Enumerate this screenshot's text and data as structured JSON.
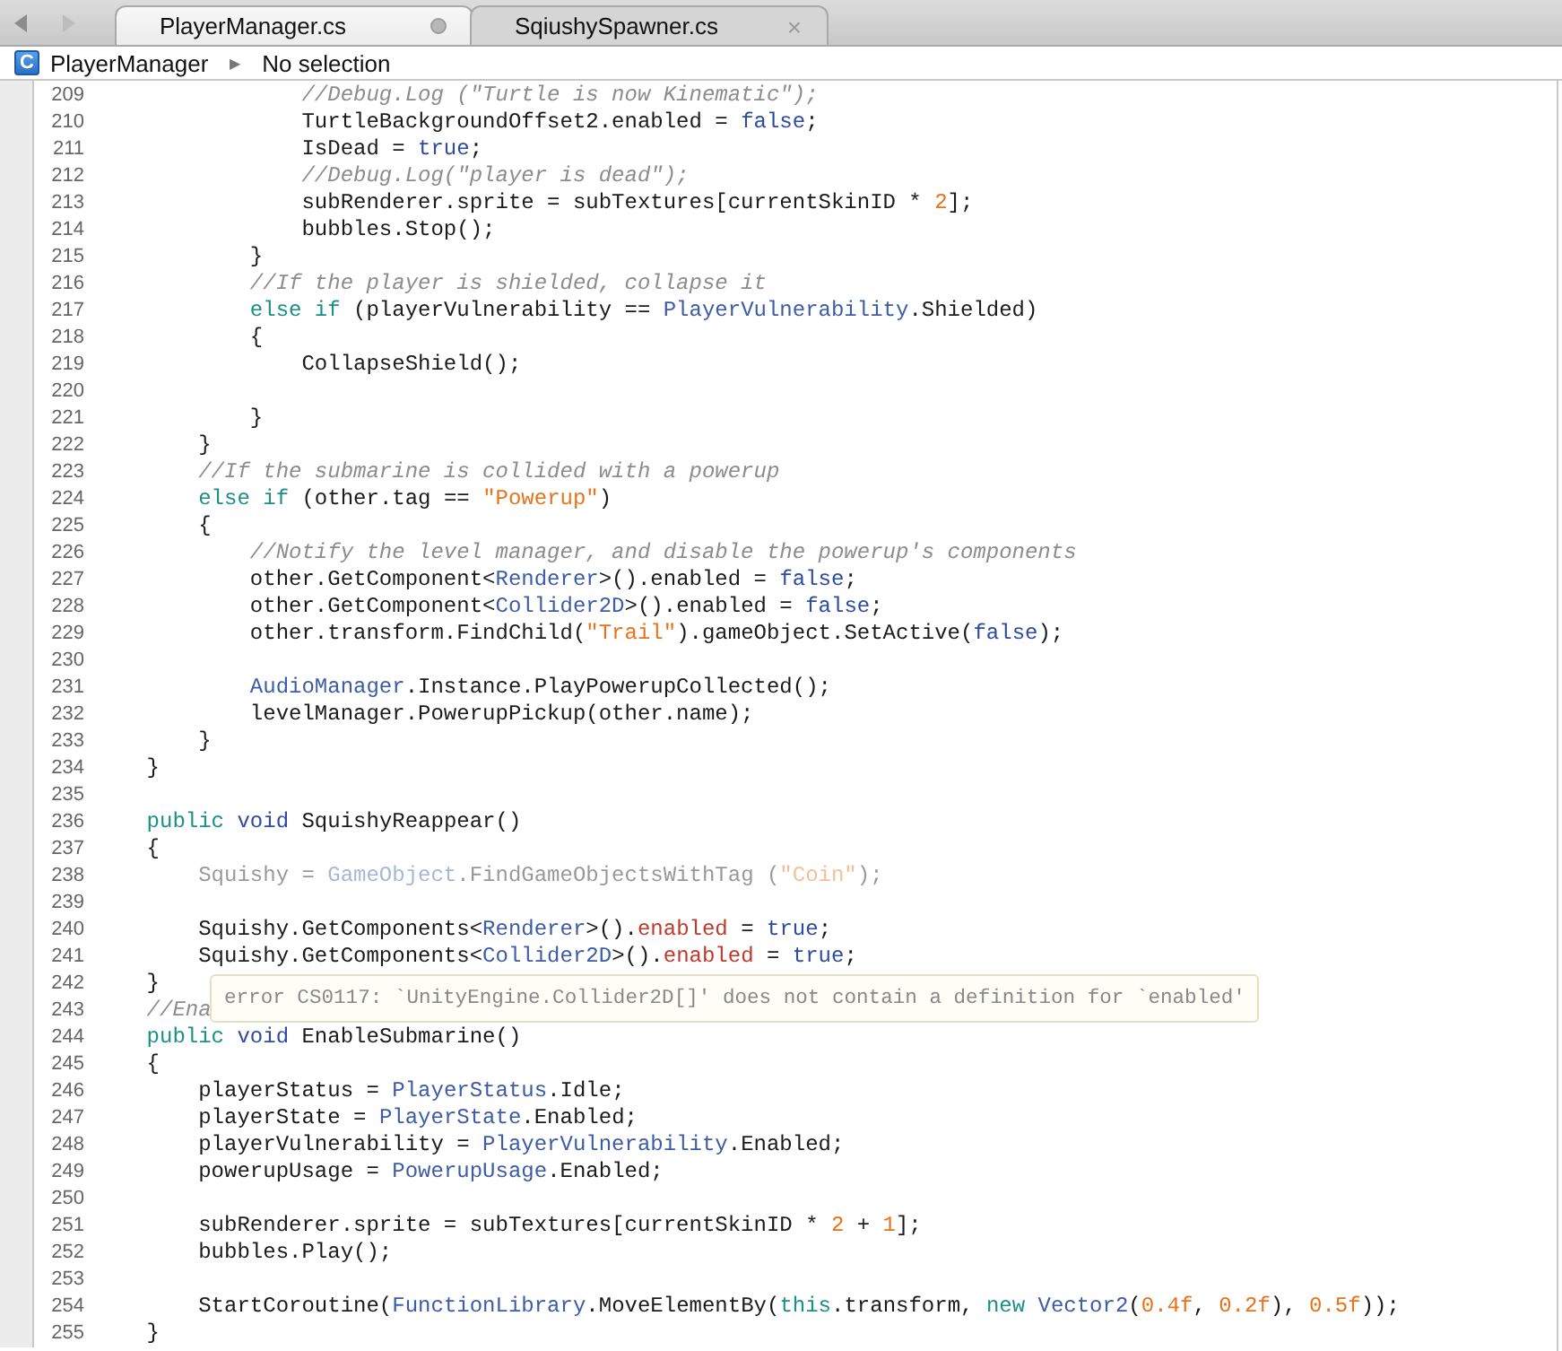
{
  "tabs": [
    {
      "label": "PlayerManager.cs",
      "selected": true,
      "modified": true
    },
    {
      "label": "SqiushySpawner.cs",
      "selected": false,
      "modified": false,
      "close": "×"
    }
  ],
  "breadcrumb": {
    "badge": "C",
    "class_name": "PlayerManager",
    "separator": "▶",
    "member": "No selection"
  },
  "lines": [
    {
      "number": "209",
      "tokens": [
        {
          "kind": "comment",
          "text": "                //Debug.Log (\"Turtle is now Kinematic\");"
        }
      ]
    },
    {
      "number": "210",
      "tokens": [
        {
          "kind": "plain",
          "text": "                TurtleBackgroundOffset2.enabled = "
        },
        {
          "kind": "literal",
          "text": "false"
        },
        {
          "kind": "plain",
          "text": ";"
        }
      ]
    },
    {
      "number": "211",
      "tokens": [
        {
          "kind": "plain",
          "text": "                IsDead = "
        },
        {
          "kind": "literal",
          "text": "true"
        },
        {
          "kind": "plain",
          "text": ";"
        }
      ]
    },
    {
      "number": "212",
      "tokens": [
        {
          "kind": "comment",
          "text": "                //Debug.Log(\"player is dead\");"
        }
      ]
    },
    {
      "number": "213",
      "tokens": [
        {
          "kind": "plain",
          "text": "                subRenderer.sprite = subTextures[currentSkinID * "
        },
        {
          "kind": "number",
          "text": "2"
        },
        {
          "kind": "plain",
          "text": "];"
        }
      ]
    },
    {
      "number": "214",
      "tokens": [
        {
          "kind": "plain",
          "text": "                bubbles.Stop();"
        }
      ]
    },
    {
      "number": "215",
      "tokens": [
        {
          "kind": "plain",
          "text": "            }"
        }
      ]
    },
    {
      "number": "216",
      "tokens": [
        {
          "kind": "comment",
          "text": "            //If the player is shielded, collapse it"
        }
      ]
    },
    {
      "number": "217",
      "tokens": [
        {
          "kind": "keyword",
          "text": "            else if"
        },
        {
          "kind": "plain",
          "text": " (playerVulnerability == "
        },
        {
          "kind": "type",
          "text": "PlayerVulnerability"
        },
        {
          "kind": "plain",
          "text": ".Shielded)"
        }
      ]
    },
    {
      "number": "218",
      "tokens": [
        {
          "kind": "plain",
          "text": "            {"
        }
      ]
    },
    {
      "number": "219",
      "tokens": [
        {
          "kind": "plain",
          "text": "                CollapseShield();"
        }
      ]
    },
    {
      "number": "220"
    },
    {
      "number": "221",
      "tokens": [
        {
          "kind": "plain",
          "text": "            }"
        }
      ]
    },
    {
      "number": "222",
      "tokens": [
        {
          "kind": "plain",
          "text": "        }"
        }
      ]
    },
    {
      "number": "223",
      "tokens": [
        {
          "kind": "comment",
          "text": "        //If the submarine is collided with a powerup"
        }
      ]
    },
    {
      "number": "224",
      "tokens": [
        {
          "kind": "keyword",
          "text": "        else if"
        },
        {
          "kind": "plain",
          "text": " (other.tag == "
        },
        {
          "kind": "string",
          "text": "\"Powerup\""
        },
        {
          "kind": "plain",
          "text": ")"
        }
      ]
    },
    {
      "number": "225",
      "tokens": [
        {
          "kind": "plain",
          "text": "        {"
        }
      ]
    },
    {
      "number": "226",
      "tokens": [
        {
          "kind": "comment",
          "text": "            //Notify the level manager, and disable the powerup's components"
        }
      ]
    },
    {
      "number": "227",
      "tokens": [
        {
          "kind": "plain",
          "text": "            other.GetComponent<"
        },
        {
          "kind": "type",
          "text": "Renderer"
        },
        {
          "kind": "plain",
          "text": ">().enabled = "
        },
        {
          "kind": "literal",
          "text": "false"
        },
        {
          "kind": "plain",
          "text": ";"
        }
      ]
    },
    {
      "number": "228",
      "tokens": [
        {
          "kind": "plain",
          "text": "            other.GetComponent<"
        },
        {
          "kind": "type",
          "text": "Collider2D"
        },
        {
          "kind": "plain",
          "text": ">().enabled = "
        },
        {
          "kind": "literal",
          "text": "false"
        },
        {
          "kind": "plain",
          "text": ";"
        }
      ]
    },
    {
      "number": "229",
      "tokens": [
        {
          "kind": "plain",
          "text": "            other.transform.FindChild("
        },
        {
          "kind": "string",
          "text": "\"Trail\""
        },
        {
          "kind": "plain",
          "text": ").gameObject.SetActive("
        },
        {
          "kind": "literal",
          "text": "false"
        },
        {
          "kind": "plain",
          "text": ");"
        }
      ]
    },
    {
      "number": "230"
    },
    {
      "number": "231",
      "tokens": [
        {
          "kind": "type",
          "text": "            AudioManager"
        },
        {
          "kind": "plain",
          "text": ".Instance.PlayPowerupCollected();"
        }
      ]
    },
    {
      "number": "232",
      "tokens": [
        {
          "kind": "plain",
          "text": "            levelManager.PowerupPickup(other.name);"
        }
      ]
    },
    {
      "number": "233",
      "tokens": [
        {
          "kind": "plain",
          "text": "        }"
        }
      ]
    },
    {
      "number": "234",
      "tokens": [
        {
          "kind": "plain",
          "text": "    }"
        }
      ]
    },
    {
      "number": "235"
    },
    {
      "number": "236",
      "tokens": [
        {
          "kind": "keyword",
          "text": "    public "
        },
        {
          "kind": "literal",
          "text": "void"
        },
        {
          "kind": "plain",
          "text": " SquishyReappear()"
        }
      ]
    },
    {
      "number": "237",
      "tokens": [
        {
          "kind": "plain",
          "text": "    {"
        }
      ]
    },
    {
      "number": "238",
      "dimmed": true,
      "tokens": [
        {
          "kind": "plain",
          "text": "        Squishy = "
        },
        {
          "kind": "type",
          "text": "GameObject"
        },
        {
          "kind": "plain",
          "text": ".FindGameObjectsWithTag ("
        },
        {
          "kind": "string",
          "text": "\"Coin\""
        },
        {
          "kind": "plain",
          "text": ");"
        }
      ]
    },
    {
      "number": "239"
    },
    {
      "number": "240",
      "tokens": [
        {
          "kind": "plain",
          "text": "        Squishy.GetComponents<"
        },
        {
          "kind": "type",
          "text": "Renderer"
        },
        {
          "kind": "plain",
          "text": ">()."
        },
        {
          "kind": "error",
          "text": "enabled"
        },
        {
          "kind": "plain",
          "text": " = "
        },
        {
          "kind": "literal",
          "text": "true"
        },
        {
          "kind": "plain",
          "text": ";"
        }
      ]
    },
    {
      "number": "241",
      "tokens": [
        {
          "kind": "plain",
          "text": "        Squishy.GetComponents<"
        },
        {
          "kind": "type",
          "text": "Collider2D"
        },
        {
          "kind": "plain",
          "text": ">()."
        },
        {
          "kind": "error",
          "text": "enabled"
        },
        {
          "kind": "plain",
          "text": " = "
        },
        {
          "kind": "literal",
          "text": "true"
        },
        {
          "kind": "plain",
          "text": ";"
        }
      ]
    },
    {
      "number": "242",
      "tokens": [
        {
          "kind": "plain",
          "text": "    }"
        }
      ]
    },
    {
      "number": "243",
      "tokens": [
        {
          "kind": "comment",
          "text": "    //Ena"
        }
      ]
    },
    {
      "number": "244",
      "tokens": [
        {
          "kind": "keyword",
          "text": "    public "
        },
        {
          "kind": "literal",
          "text": "void"
        },
        {
          "kind": "plain",
          "text": " EnableSubmarine()"
        }
      ]
    },
    {
      "number": "245",
      "tokens": [
        {
          "kind": "plain",
          "text": "    {"
        }
      ]
    },
    {
      "number": "246",
      "tokens": [
        {
          "kind": "plain",
          "text": "        playerStatus = "
        },
        {
          "kind": "type",
          "text": "PlayerStatus"
        },
        {
          "kind": "plain",
          "text": ".Idle;"
        }
      ]
    },
    {
      "number": "247",
      "tokens": [
        {
          "kind": "plain",
          "text": "        playerState = "
        },
        {
          "kind": "type",
          "text": "PlayerState"
        },
        {
          "kind": "plain",
          "text": ".Enabled;"
        }
      ]
    },
    {
      "number": "248",
      "tokens": [
        {
          "kind": "plain",
          "text": "        playerVulnerability = "
        },
        {
          "kind": "type",
          "text": "PlayerVulnerability"
        },
        {
          "kind": "plain",
          "text": ".Enabled;"
        }
      ]
    },
    {
      "number": "249",
      "tokens": [
        {
          "kind": "plain",
          "text": "        powerupUsage = "
        },
        {
          "kind": "type",
          "text": "PowerupUsage"
        },
        {
          "kind": "plain",
          "text": ".Enabled;"
        }
      ]
    },
    {
      "number": "250"
    },
    {
      "number": "251",
      "tokens": [
        {
          "kind": "plain",
          "text": "        subRenderer.sprite = subTextures[currentSkinID * "
        },
        {
          "kind": "number",
          "text": "2"
        },
        {
          "kind": "plain",
          "text": " + "
        },
        {
          "kind": "number",
          "text": "1"
        },
        {
          "kind": "plain",
          "text": "];"
        }
      ]
    },
    {
      "number": "252",
      "tokens": [
        {
          "kind": "plain",
          "text": "        bubbles.Play();"
        }
      ]
    },
    {
      "number": "253"
    },
    {
      "number": "254",
      "tokens": [
        {
          "kind": "plain",
          "text": "        StartCoroutine("
        },
        {
          "kind": "type",
          "text": "FunctionLibrary"
        },
        {
          "kind": "plain",
          "text": ".MoveElementBy("
        },
        {
          "kind": "keyword",
          "text": "this"
        },
        {
          "kind": "plain",
          "text": ".transform, "
        },
        {
          "kind": "keyword",
          "text": "new "
        },
        {
          "kind": "type",
          "text": "Vector2"
        },
        {
          "kind": "plain",
          "text": "("
        },
        {
          "kind": "number",
          "text": "0.4f"
        },
        {
          "kind": "plain",
          "text": ", "
        },
        {
          "kind": "number",
          "text": "0.2f"
        },
        {
          "kind": "plain",
          "text": "), "
        },
        {
          "kind": "number",
          "text": "0.5f"
        },
        {
          "kind": "plain",
          "text": "));"
        }
      ]
    },
    {
      "number": "255",
      "tokens": [
        {
          "kind": "plain",
          "text": "    }"
        }
      ]
    }
  ],
  "tooltip": {
    "text": "error CS0117: `UnityEngine.Collider2D[]' does not contain a definition for `enabled'"
  }
}
